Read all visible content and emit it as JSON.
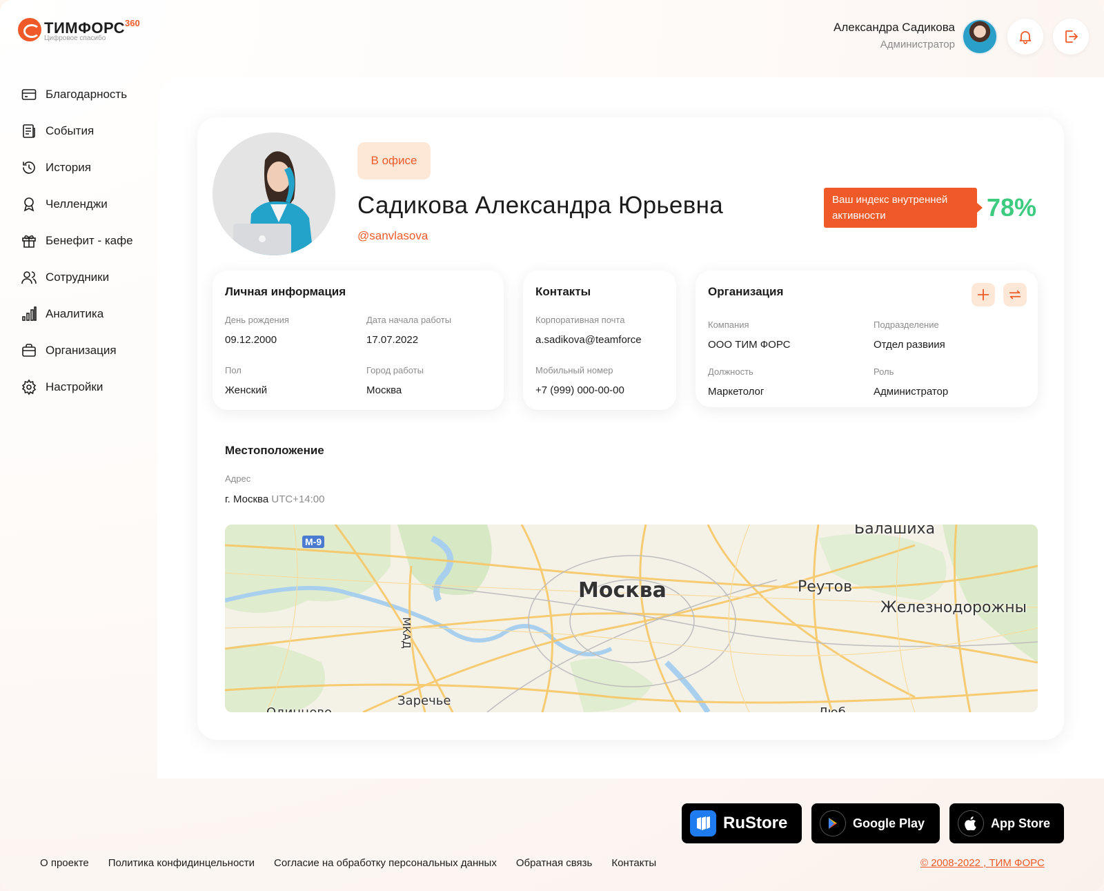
{
  "header": {
    "logo_title": "ТИМФОРС",
    "logo_sup": "360",
    "logo_tagline": "Цифровое спасибо",
    "user_name": "Александра Садикова",
    "user_role": "Администратор",
    "bell_icon": "bell-icon",
    "logout_icon": "logout-icon"
  },
  "sidebar": {
    "items": [
      {
        "label": "Благодарность",
        "icon": "card-icon"
      },
      {
        "label": "События",
        "icon": "news-icon"
      },
      {
        "label": "История",
        "icon": "history-icon"
      },
      {
        "label": "Челленджи",
        "icon": "medal-icon"
      },
      {
        "label": "Бенефит - кафе",
        "icon": "gift-icon"
      },
      {
        "label": "Сотрудники",
        "icon": "users-icon"
      },
      {
        "label": "Аналитика",
        "icon": "chart-icon"
      },
      {
        "label": "Организация",
        "icon": "briefcase-icon"
      },
      {
        "label": "Настройки",
        "icon": "gear-icon"
      }
    ]
  },
  "profile": {
    "status": "В офисе",
    "full_name": "Садикова Александра Юрьевна",
    "username": "@sanvlasova",
    "index_label": "Ваш индекс внутренней активности",
    "index_value": "78%"
  },
  "personal": {
    "title": "Личная информация",
    "birthday_label": "День рождения",
    "birthday": "09.12.2000",
    "start_label": "Дата начала работы",
    "start": "17.07.2022",
    "gender_label": "Пол",
    "gender": "Женский",
    "city_label": "Город работы",
    "city": "Москва"
  },
  "contacts": {
    "title": "Контакты",
    "email_label": "Корпоративная почта",
    "email": "a.sadikova@teamforce",
    "phone_label": "Мобильный номер",
    "phone": "+7 (999) 000-00-00"
  },
  "organization": {
    "title": "Организация",
    "company_label": "Компания",
    "company": "ООО ТИМ ФОРС",
    "department_label": "Подразделение",
    "department": "Отдел развиия",
    "position_label": "Должность",
    "position": "Маркетолог",
    "role_label": "Роль",
    "role": "Администратор"
  },
  "location": {
    "title": "Местоположение",
    "address_label": "Адрес",
    "address": "г. Москва",
    "timezone": "UTC+14:00",
    "map": {
      "city": "Москва",
      "labels": [
        "Балашиха",
        "Реутов",
        "Железнодорожны",
        "МКАД",
        "Заречье",
        "Одинцово",
        "Люб"
      ],
      "road": "M-9"
    }
  },
  "stores": {
    "rustore": "RuStore",
    "google": "Google Play",
    "apple": "App Store"
  },
  "footer": {
    "links": [
      "О проекте",
      "Политика конфидинцельности",
      "Согласие на обработку персональных данных",
      "Обратная связь",
      "Контакты"
    ],
    "copyright": "© 2008-2022 , ТИМ ФОРС"
  },
  "colors": {
    "accent": "#f05a28",
    "accent_light": "#fde8d8",
    "positive": "#3ccb7f"
  }
}
